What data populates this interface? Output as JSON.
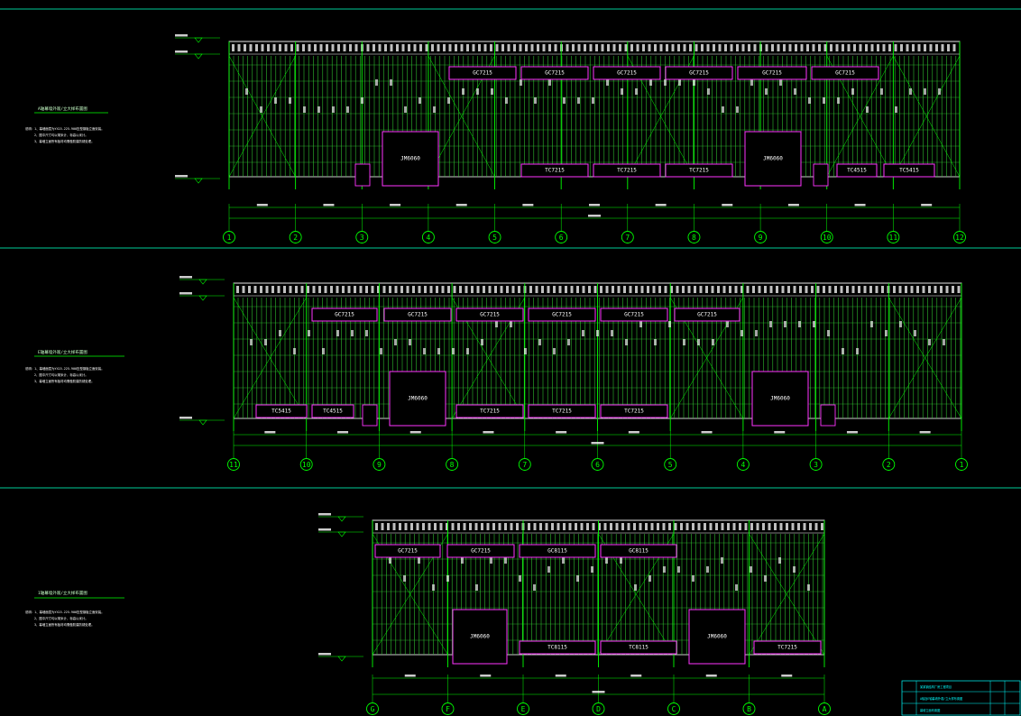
{
  "colors": {
    "background": "#000000",
    "frame": "#00ff00",
    "grid": "#33cc33",
    "white": "#ffffff",
    "magenta": "#ff33ff",
    "cyan": "#00ffff",
    "yellow": "#ffff00"
  },
  "views": [
    {
      "id": "view-1",
      "notes_title": "A轴幕墙外观/立大样布置图",
      "notes": [
        "说明：1、幕墙面层为YX15-225-900压型钢板立面安装。",
        "2、图中尺寸均以毫米计，标高以米计。",
        "3、幕墙立面所有板材均需做防腐防锈处理。"
      ],
      "axes": [
        "1",
        "2",
        "3",
        "4",
        "5",
        "6",
        "7",
        "8",
        "9",
        "10",
        "11",
        "12"
      ],
      "windows_top": [
        "GC7215",
        "GC7215",
        "GC7215",
        "GC7215",
        "GC7215",
        "GC7215"
      ],
      "windows_bottom": [
        "TC7215",
        "TC7215",
        "TC7215",
        "TC4515",
        "TC5415"
      ],
      "doors": [
        "JM6060",
        "JM6060"
      ]
    },
    {
      "id": "view-2",
      "notes_title": "E轴幕墙外观/立大样布置图",
      "notes": [
        "说明：1、幕墙面层为YX15-225-900压型钢板立面安装。",
        "2、图中尺寸均以毫米计，标高以米计。",
        "3、幕墙立面所有板材均需做防腐防锈处理。"
      ],
      "axes": [
        "11",
        "10",
        "9",
        "8",
        "7",
        "6",
        "5",
        "4",
        "3",
        "2",
        "1"
      ],
      "windows_top": [
        "GC7215",
        "GC7215",
        "GC7215",
        "GC7215",
        "GC7215",
        "GC7215"
      ],
      "windows_bottom": [
        "TC5415",
        "TC4515",
        "TC7215",
        "TC7215",
        "TC7215"
      ],
      "doors": [
        "JM6060",
        "JM6060"
      ]
    },
    {
      "id": "view-3",
      "notes_title": "1轴幕墙外观/立大样布置图",
      "notes": [
        "说明：1、幕墙面层为YX15-225-900压型钢板立面安装。",
        "2、图中尺寸均以毫米计，标高以米计。",
        "3、幕墙立面所有板材均需做防腐防锈处理。"
      ],
      "axes": [
        "G",
        "F",
        "E",
        "D",
        "C",
        "B",
        "A"
      ],
      "windows_top": [
        "GC7215",
        "GC7215",
        "GC8115",
        "GC8115"
      ],
      "windows_bottom": [
        "TC8115",
        "TC8115",
        "TC7215"
      ],
      "doors": [
        "JM6060",
        "JM6060"
      ]
    }
  ],
  "title_block": {
    "row1": "某某钢结构厂房工程项目",
    "row2": "A轴及E轴幕墙外观/立大样布置图",
    "row3": "幕墙立面布置图"
  }
}
